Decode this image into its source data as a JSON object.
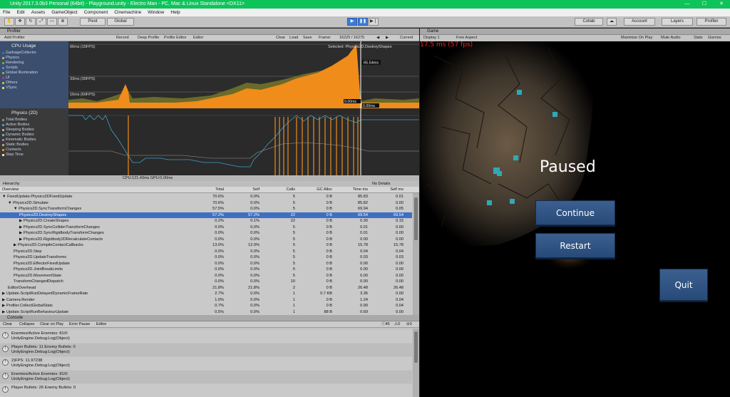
{
  "window": {
    "title": "Unity 2017.3.0b3 Personal (64bit) - Playground.unity - Electro Man - PC, Mac & Linux Standalone <DX11>"
  },
  "menu": [
    "File",
    "Edit",
    "Assets",
    "GameObject",
    "Component",
    "Cinemachine",
    "Window",
    "Help"
  ],
  "toolbar": {
    "pivot": "Pivot",
    "global": "Global",
    "collab": "Collab",
    "account": "Account",
    "layers": "Layers",
    "layout": "Profiler"
  },
  "profiler": {
    "tab": "Profiler",
    "add": "Add Profiler",
    "buttons": [
      "Record",
      "Deep Profile",
      "Profile Editor",
      "Editor"
    ],
    "right_buttons": [
      "Clear",
      "Load",
      "Save"
    ],
    "frame_label": "Frame:",
    "frame_value": "16225 / 16275",
    "current": "Current",
    "cpu": {
      "title": "CPU Usage",
      "items": [
        "GarbageCollector",
        "Physics",
        "Rendering",
        "Scripts",
        "Global Illumination",
        "UI",
        "Others",
        "VSync"
      ]
    },
    "phys": {
      "title": "Physics (2D)",
      "items": [
        "Total Bodies",
        "Active Bodies",
        "Sleeping Bodies",
        "Dynamic Bodies",
        "Kinematic Bodies",
        "Static Bodies",
        "Contacts",
        "Step Time"
      ]
    },
    "chart_labels": {
      "l66": "66ms (15FPS)",
      "l33": "33ms (30FPS)",
      "l16": "16ms (60FPS)",
      "selected": "Selected: Physics2D.DestroyShapes",
      "ms1": "65.54ms",
      "ms2": "0.00ms",
      "ms3": "0.00ms"
    },
    "cpu_status": "CPU:121.43ms  GPU:0.00ms",
    "hierarchy_label": "Hierarchy",
    "details_label": "No Details",
    "columns": [
      "Overview",
      "Total",
      "Self",
      "Calls",
      "GC Alloc",
      "Time ms",
      "Self ms"
    ],
    "rows": [
      {
        "name": "▼ FixedUpdate.Physics2DFixedUpdate",
        "indent": 0,
        "total": "70.6%",
        "self": "0.0%",
        "calls": "5",
        "gc": "0 B",
        "time": "85.83",
        "selfms": "0.01"
      },
      {
        "name": "▼ Physics2D.Simulate",
        "indent": 1,
        "total": "70.6%",
        "self": "0.0%",
        "calls": "5",
        "gc": "0 B",
        "time": "85.82",
        "selfms": "0.00"
      },
      {
        "name": "▼ Physics2D.SyncTransformChanges",
        "indent": 2,
        "total": "57.5%",
        "self": "0.0%",
        "calls": "5",
        "gc": "0 B",
        "time": "69.94",
        "selfms": "0.05"
      },
      {
        "name": "Physics2D.DestroyShapes",
        "indent": 3,
        "total": "57.2%",
        "self": "57.2%",
        "calls": "22",
        "gc": "0 B",
        "time": "69.54",
        "selfms": "69.54",
        "selected": true
      },
      {
        "name": "▶ Physics2D.CreateShapes",
        "indent": 3,
        "total": "0.2%",
        "self": "0.1%",
        "calls": "22",
        "gc": "0 B",
        "time": "0.30",
        "selfms": "0.15"
      },
      {
        "name": "▶ Physics2D.SyncColliderTransformChanges",
        "indent": 3,
        "total": "0.0%",
        "self": "0.0%",
        "calls": "5",
        "gc": "0 B",
        "time": "0.01",
        "selfms": "0.00"
      },
      {
        "name": "▶ Physics2D.SyncRigidbodyTransformChanges",
        "indent": 3,
        "total": "0.0%",
        "self": "0.0%",
        "calls": "5",
        "gc": "0 B",
        "time": "0.01",
        "selfms": "0.00"
      },
      {
        "name": "▶ Physics2D.Rigidbody2DRecalculateContacts",
        "indent": 3,
        "total": "0.0%",
        "self": "0.0%",
        "calls": "5",
        "gc": "0 B",
        "time": "0.00",
        "selfms": "0.00"
      },
      {
        "name": "▶ Physics2D.CompileContactCallbacks",
        "indent": 2,
        "total": "13.0%",
        "self": "12.9%",
        "calls": "5",
        "gc": "0 B",
        "time": "15.78",
        "selfms": "15.78"
      },
      {
        "name": "Physics2D.Step",
        "indent": 2,
        "total": "0.0%",
        "self": "0.0%",
        "calls": "5",
        "gc": "0 B",
        "time": "0.04",
        "selfms": "0.04"
      },
      {
        "name": "Physics2D.UpdateTransforms",
        "indent": 2,
        "total": "0.0%",
        "self": "0.0%",
        "calls": "5",
        "gc": "0 B",
        "time": "0.03",
        "selfms": "0.03"
      },
      {
        "name": "Physics2D.EffectorFixedUpdate",
        "indent": 2,
        "total": "0.0%",
        "self": "0.0%",
        "calls": "5",
        "gc": "0 B",
        "time": "0.00",
        "selfms": "0.00"
      },
      {
        "name": "Physics2D.JointBreakLimits",
        "indent": 2,
        "total": "0.0%",
        "self": "0.0%",
        "calls": "5",
        "gc": "0 B",
        "time": "0.00",
        "selfms": "0.00"
      },
      {
        "name": "Physics2D.MovementState",
        "indent": 2,
        "total": "0.0%",
        "self": "0.0%",
        "calls": "5",
        "gc": "0 B",
        "time": "0.00",
        "selfms": "0.00"
      },
      {
        "name": "TransformChangedDispatch",
        "indent": 2,
        "total": "0.0%",
        "self": "0.0%",
        "calls": "10",
        "gc": "0 B",
        "time": "0.00",
        "selfms": "0.00"
      },
      {
        "name": "EditorOverhead",
        "indent": 1,
        "total": "21.8%",
        "self": "21.8%",
        "calls": "2",
        "gc": "0 B",
        "time": "26.48",
        "selfms": "26.48"
      },
      {
        "name": "▶ Update.ScriptRunDelayedDynamicFrameRate",
        "indent": 0,
        "total": "2.7%",
        "self": "0.0%",
        "calls": "1",
        "gc": "0.7 KB",
        "time": "3.36",
        "selfms": "0.00"
      },
      {
        "name": "▶ Camera.Render",
        "indent": 0,
        "total": "1.0%",
        "self": "0.0%",
        "calls": "1",
        "gc": "0 B",
        "time": "1.24",
        "selfms": "0.04"
      },
      {
        "name": "▶ Profiler.CollectGlobalStats",
        "indent": 0,
        "total": "0.7%",
        "self": "0.0%",
        "calls": "1",
        "gc": "0 B",
        "time": "0.90",
        "selfms": "0.04"
      },
      {
        "name": "▶ Update.ScriptRunBehaviourUpdate",
        "indent": 0,
        "total": "0.5%",
        "self": "0.0%",
        "calls": "1",
        "gc": "88 B",
        "time": "0.69",
        "selfms": "0.00"
      }
    ]
  },
  "console": {
    "tab": "Console",
    "buttons": [
      "Clear",
      "Collapse",
      "Clear on Play",
      "Error Pause",
      "Editor"
    ],
    "counts": [
      "46",
      "0",
      "0"
    ],
    "entries": [
      {
        "l1": "Enemies/Active Enemies: 81/0",
        "l2": "UnityEngine.Debug:Log(Object)"
      },
      {
        "l1": "Player Bullets: 11 Enemy Bullets: 0",
        "l2": "UnityEngine.Debug:Log(Object)"
      },
      {
        "l1": "2)FPS: 11.97238",
        "l2": "UnityEngine.Debug:Log(Object)"
      },
      {
        "l1": "Enemies/Active Enemies: 81/0",
        "l2": "UnityEngine.Debug:Log(Object)"
      },
      {
        "l1": "Player Bullets: 26 Enemy Bullets: 0",
        "l2": ""
      }
    ]
  },
  "game": {
    "tab": "Game",
    "display": "Display 1",
    "aspect": "Free Aspect",
    "options": [
      "Maximize On Play",
      "Mute Audio",
      "Stats",
      "Gizmos"
    ],
    "fps": "17.5 ms (57 fps)",
    "paused": "Paused",
    "continue": "Continue",
    "restart": "Restart",
    "quit": "Quit"
  },
  "colors": {
    "accent": "#3d6fc3",
    "cpu_fill": "#f08c1a",
    "phys_line": "#3ea0c8",
    "game_button": "#2f5585",
    "fps_text": "#ff2020"
  }
}
